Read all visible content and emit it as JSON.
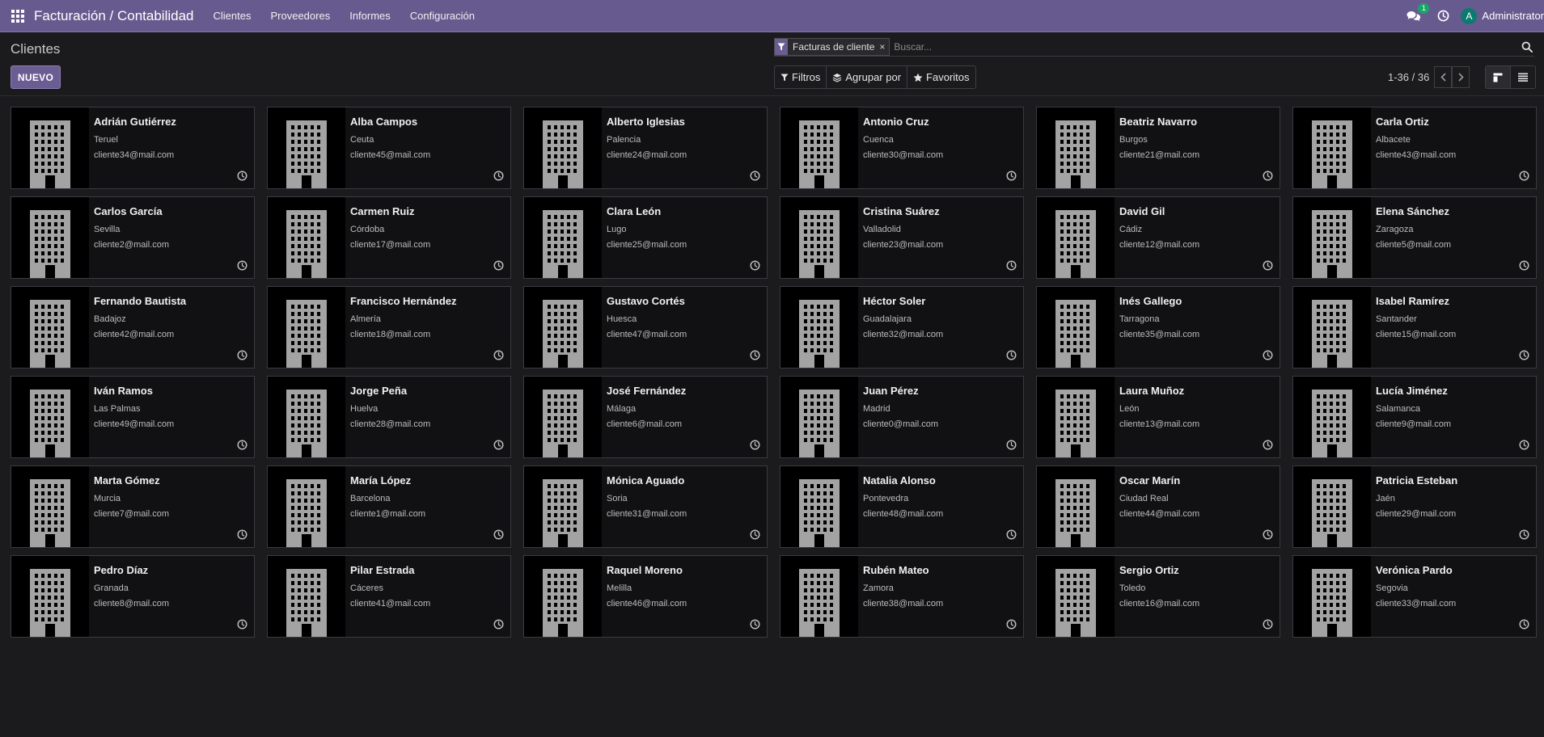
{
  "navbar": {
    "app_title": "Facturación / Contabilidad",
    "menu": [
      "Clientes",
      "Proveedores",
      "Informes",
      "Configuración"
    ],
    "messages_count": "1",
    "user_initial": "A",
    "user_name": "Administrator",
    "bar_color": "#675a8f"
  },
  "control_panel": {
    "title": "Clientes",
    "new_button": "NUEVO",
    "facet_label": "Facturas de cliente",
    "facet_remove": "×",
    "search_placeholder": "Buscar...",
    "filters": "Filtros",
    "group_by": "Agrupar por",
    "favorites": "Favoritos",
    "pager": "1-36 / 36"
  },
  "customers": [
    {
      "name": "Adrián Gutiérrez",
      "city": "Teruel",
      "email": "cliente34@mail.com"
    },
    {
      "name": "Alba Campos",
      "city": "Ceuta",
      "email": "cliente45@mail.com"
    },
    {
      "name": "Alberto Iglesias",
      "city": "Palencia",
      "email": "cliente24@mail.com"
    },
    {
      "name": "Antonio Cruz",
      "city": "Cuenca",
      "email": "cliente30@mail.com"
    },
    {
      "name": "Beatriz Navarro",
      "city": "Burgos",
      "email": "cliente21@mail.com"
    },
    {
      "name": "Carla Ortiz",
      "city": "Albacete",
      "email": "cliente43@mail.com"
    },
    {
      "name": "Carlos García",
      "city": "Sevilla",
      "email": "cliente2@mail.com"
    },
    {
      "name": "Carmen Ruiz",
      "city": "Córdoba",
      "email": "cliente17@mail.com"
    },
    {
      "name": "Clara León",
      "city": "Lugo",
      "email": "cliente25@mail.com"
    },
    {
      "name": "Cristina Suárez",
      "city": "Valladolid",
      "email": "cliente23@mail.com"
    },
    {
      "name": "David Gil",
      "city": "Cádiz",
      "email": "cliente12@mail.com"
    },
    {
      "name": "Elena Sánchez",
      "city": "Zaragoza",
      "email": "cliente5@mail.com"
    },
    {
      "name": "Fernando Bautista",
      "city": "Badajoz",
      "email": "cliente42@mail.com"
    },
    {
      "name": "Francisco Hernández",
      "city": "Almería",
      "email": "cliente18@mail.com"
    },
    {
      "name": "Gustavo Cortés",
      "city": "Huesca",
      "email": "cliente47@mail.com"
    },
    {
      "name": "Héctor Soler",
      "city": "Guadalajara",
      "email": "cliente32@mail.com"
    },
    {
      "name": "Inés Gallego",
      "city": "Tarragona",
      "email": "cliente35@mail.com"
    },
    {
      "name": "Isabel Ramírez",
      "city": "Santander",
      "email": "cliente15@mail.com"
    },
    {
      "name": "Iván Ramos",
      "city": "Las Palmas",
      "email": "cliente49@mail.com"
    },
    {
      "name": "Jorge Peña",
      "city": "Huelva",
      "email": "cliente28@mail.com"
    },
    {
      "name": "José Fernández",
      "city": "Málaga",
      "email": "cliente6@mail.com"
    },
    {
      "name": "Juan Pérez",
      "city": "Madrid",
      "email": "cliente0@mail.com"
    },
    {
      "name": "Laura Muñoz",
      "city": "León",
      "email": "cliente13@mail.com"
    },
    {
      "name": "Lucía Jiménez",
      "city": "Salamanca",
      "email": "cliente9@mail.com"
    },
    {
      "name": "Marta Gómez",
      "city": "Murcia",
      "email": "cliente7@mail.com"
    },
    {
      "name": "María López",
      "city": "Barcelona",
      "email": "cliente1@mail.com"
    },
    {
      "name": "Mónica Aguado",
      "city": "Soria",
      "email": "cliente31@mail.com"
    },
    {
      "name": "Natalia Alonso",
      "city": "Pontevedra",
      "email": "cliente48@mail.com"
    },
    {
      "name": "Oscar Marín",
      "city": "Ciudad Real",
      "email": "cliente44@mail.com"
    },
    {
      "name": "Patricia Esteban",
      "city": "Jaén",
      "email": "cliente29@mail.com"
    },
    {
      "name": "Pedro Díaz",
      "city": "Granada",
      "email": "cliente8@mail.com"
    },
    {
      "name": "Pilar Estrada",
      "city": "Cáceres",
      "email": "cliente41@mail.com"
    },
    {
      "name": "Raquel Moreno",
      "city": "Melilla",
      "email": "cliente46@mail.com"
    },
    {
      "name": "Rubén Mateo",
      "city": "Zamora",
      "email": "cliente38@mail.com"
    },
    {
      "name": "Sergio Ortiz",
      "city": "Toledo",
      "email": "cliente16@mail.com"
    },
    {
      "name": "Verónica Pardo",
      "city": "Segovia",
      "email": "cliente33@mail.com"
    }
  ],
  "icons": {
    "apps": "apps-grid-icon",
    "chat": "chat-icon",
    "clock": "clock-icon",
    "facet": "filter-icon",
    "search": "search-icon",
    "layers": "layers-icon",
    "star": "star-icon",
    "card_image": "building-icon",
    "activity": "clock-icon",
    "kanban_view": "kanban-view-icon",
    "list_view": "list-view-icon"
  }
}
